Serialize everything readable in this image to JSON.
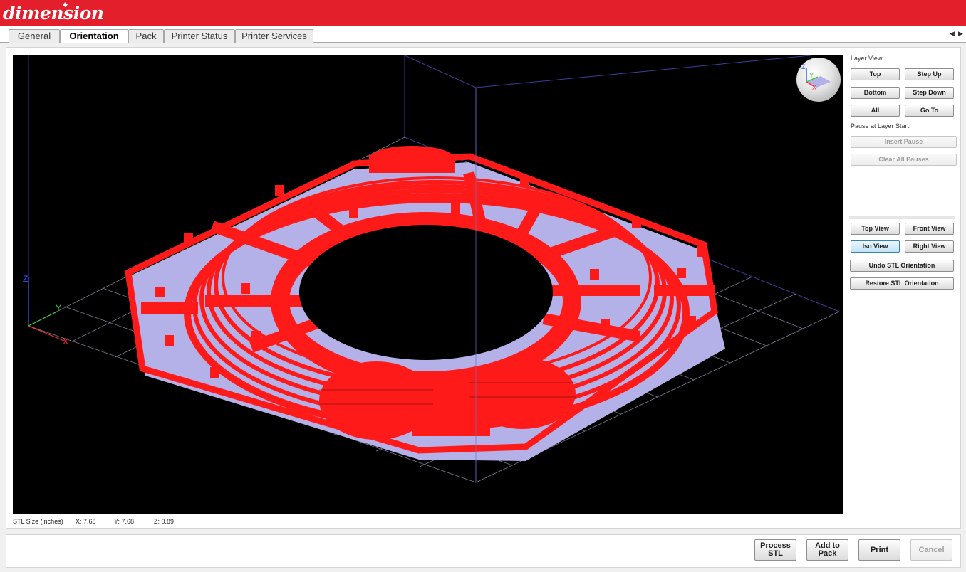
{
  "brand": {
    "logo_text": "dimension",
    "logo_mark": "◆"
  },
  "tabs": [
    {
      "label": "General",
      "active": false
    },
    {
      "label": "Orientation",
      "active": true
    },
    {
      "label": "Pack",
      "active": false
    },
    {
      "label": "Printer Status",
      "active": false
    },
    {
      "label": "Printer Services",
      "active": false
    }
  ],
  "tab_scroll": {
    "left": "◀",
    "right": "▶"
  },
  "axes": {
    "z": "Z",
    "y": "Y",
    "x": "X"
  },
  "nav_cube": {
    "z": "Z",
    "y": "Y",
    "x": "X"
  },
  "stl_size": {
    "label": "STL Size (inches)",
    "x": "X:  7.68",
    "y": "Y:  7.68",
    "z": "Z:  0.89"
  },
  "layer_view": {
    "label": "Layer View:",
    "top": "Top",
    "step_up": "Step Up",
    "bottom": "Bottom",
    "step_down": "Step Down",
    "all": "All",
    "go_to": "Go To"
  },
  "pause": {
    "label": "Pause at Layer Start:",
    "insert": "Insert Pause",
    "clear": "Clear All Pauses"
  },
  "views": {
    "top": "Top View",
    "front": "Front View",
    "iso": "Iso View",
    "right": "Right View",
    "undo": "Undo STL Orientation",
    "restore": "Restore STL Orientation"
  },
  "actions": {
    "process": "Process STL",
    "add": "Add to Pack",
    "print": "Print",
    "cancel": "Cancel"
  },
  "colors": {
    "brand_red": "#e31f2b",
    "model_red": "#ff1a1a",
    "base_lavender": "#b4b0e8"
  }
}
